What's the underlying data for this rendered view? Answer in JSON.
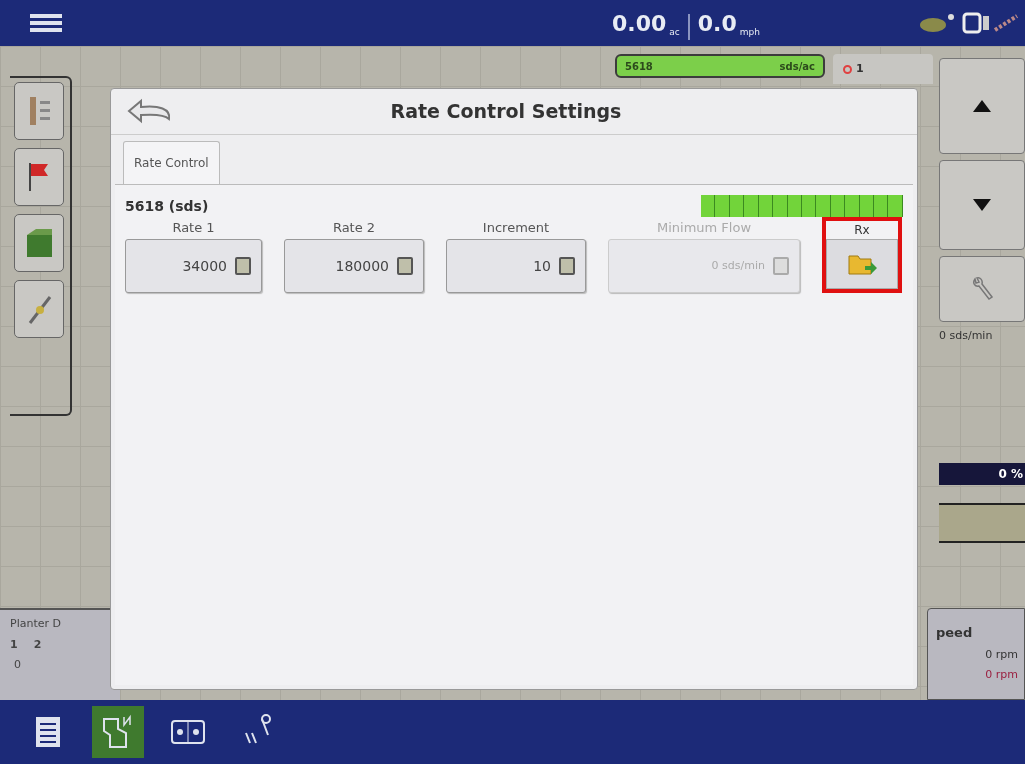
{
  "top_bar": {
    "area": "0.00",
    "area_unit": "ac",
    "speed": "0.0",
    "speed_unit": "mph"
  },
  "product_tag": {
    "name": "5618",
    "unit": "sds/ac"
  },
  "alarm_tab": {
    "count": "1"
  },
  "right_panel": {
    "rate_reading": "0 sds/min",
    "progress": {
      "level": 0,
      "reading": "0 %"
    }
  },
  "planter_panel": {
    "title": "Planter D",
    "rows": [
      "1",
      "2"
    ],
    "value": "0"
  },
  "speed_panel": {
    "title": "peed",
    "readings": [
      {
        "text": "0 rpm",
        "alert": false
      },
      {
        "text": "0 rpm",
        "alert": true
      }
    ]
  },
  "dialog": {
    "title": "Rate Control Settings",
    "tabs": [
      {
        "label": "Rate Control",
        "selected": true
      }
    ],
    "section": "5618 (sds)",
    "meter": {
      "level": 1
    },
    "fields": [
      {
        "label": "Rate 1",
        "value": "34000",
        "disabled": false
      },
      {
        "label": "Rate 2",
        "value": "180000",
        "disabled": false
      },
      {
        "label": "Increment",
        "value": "10",
        "disabled": false
      },
      {
        "label": "Minimum Flow",
        "value": "0 sds/min",
        "disabled": true
      }
    ],
    "rx": {
      "label": "Rx",
      "highlighted": true
    }
  },
  "taskbar": [
    {
      "kind": "document",
      "selected": false
    },
    {
      "kind": "map",
      "selected": true
    },
    {
      "kind": "split",
      "selected": false
    },
    {
      "kind": "tools",
      "selected": false
    }
  ]
}
